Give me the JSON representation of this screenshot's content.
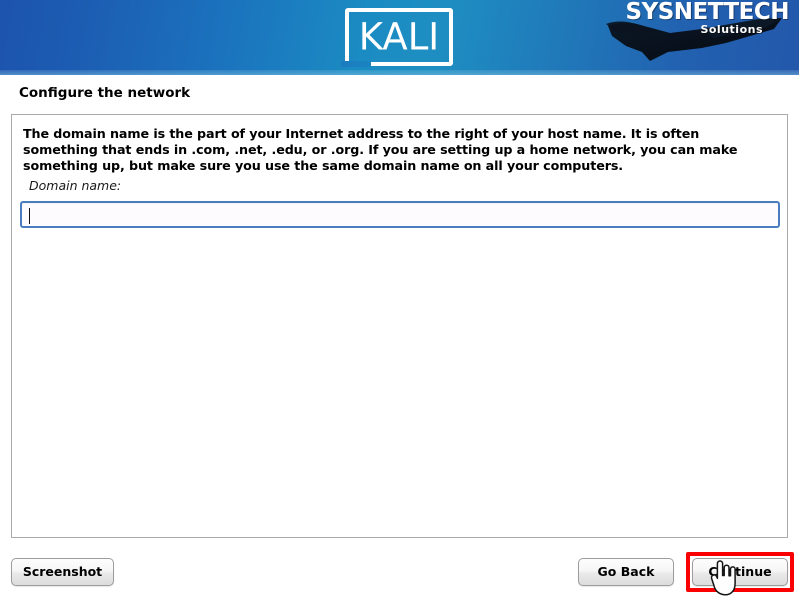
{
  "header": {
    "kali_logo_text": "KALI",
    "brand_title": "SYSNETTECH",
    "brand_subtitle": "Solutions",
    "plane_icon": "jet-plane-icon"
  },
  "page": {
    "title": "Configure the network"
  },
  "content": {
    "description": "The domain name is the part of your Internet address to the right of your host name.  It is often something that ends in .com, .net, .edu, or .org.  If you are setting up a home network, you can make something up, but make sure you use the same domain name on all your computers.",
    "field_label": "Domain name:",
    "field_value": "",
    "field_placeholder": ""
  },
  "buttons": {
    "screenshot": "Screenshot",
    "go_back": "Go Back",
    "continue": "Continue"
  },
  "annotation": {
    "highlight_color": "#fb0000",
    "cursor": "pointing-hand-cursor"
  },
  "colors": {
    "banner_left": "#1d54ad",
    "banner_mid": "#1b8cc3",
    "banner_right": "#2358ab",
    "input_border": "#4a7cc0",
    "panel_border": "#a9a9a9"
  }
}
